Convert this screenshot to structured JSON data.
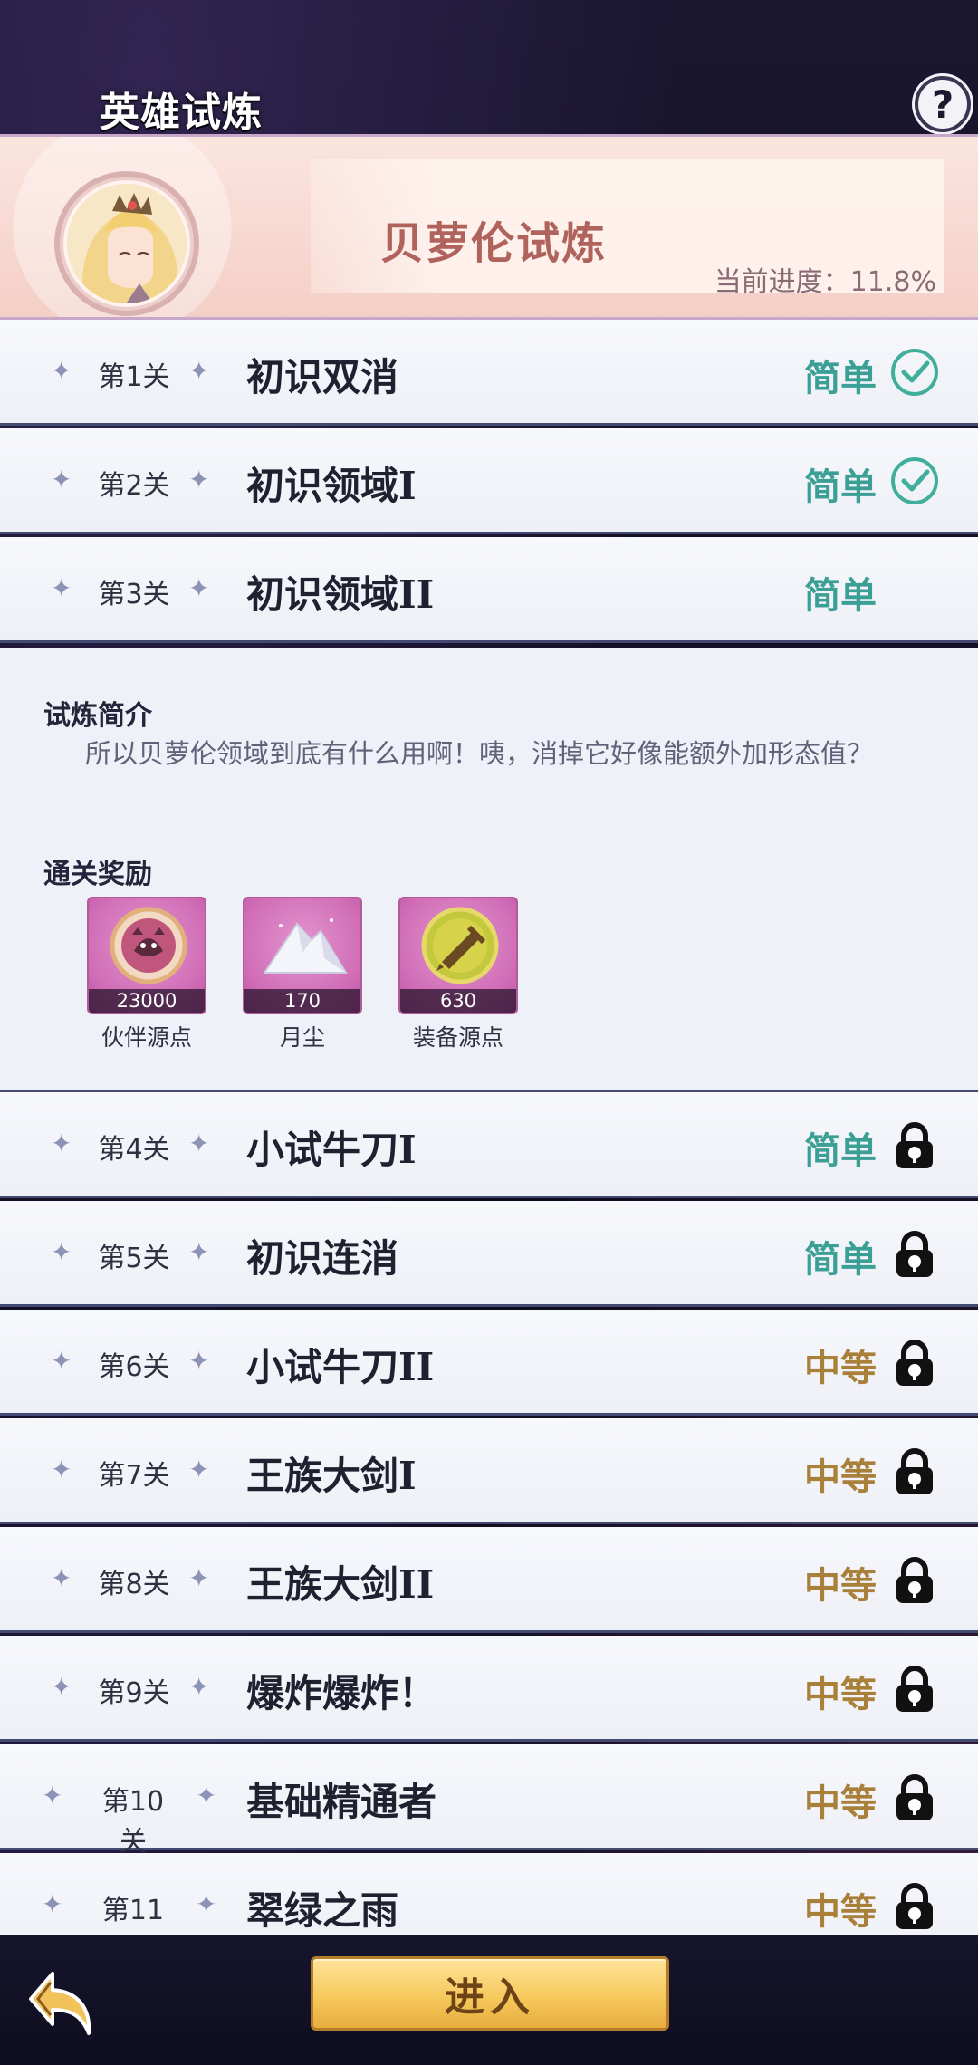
{
  "header": {
    "title": "英雄试炼",
    "help_label": "?"
  },
  "hero": {
    "name": "贝萝伦试炼",
    "progress": "当前进度：11.8%"
  },
  "levels": [
    {
      "stage": "第1关",
      "name": "初识双消",
      "difficulty": "简单",
      "status": "check-icon"
    },
    {
      "stage": "第2关",
      "name": "初识领域I",
      "difficulty": "简单",
      "status": "check-icon"
    },
    {
      "stage": "第3关",
      "name": "初识领域II",
      "difficulty": "简单",
      "status": "none"
    },
    {
      "stage": "第4关",
      "name": "小试牛刀I",
      "difficulty": "简单",
      "status": "lock-icon"
    },
    {
      "stage": "第5关",
      "name": "初识连消",
      "difficulty": "简单",
      "status": "lock-icon"
    },
    {
      "stage": "第6关",
      "name": "小试牛刀II",
      "difficulty": "中等",
      "status": "lock-icon"
    },
    {
      "stage": "第7关",
      "name": "王族大剑I",
      "difficulty": "中等",
      "status": "lock-icon"
    },
    {
      "stage": "第8关",
      "name": "王族大剑II",
      "difficulty": "中等",
      "status": "lock-icon"
    },
    {
      "stage": "第9关",
      "name": "爆炸爆炸！",
      "difficulty": "中等",
      "status": "lock-icon"
    },
    {
      "stage": "第10关",
      "name": "基础精通者",
      "difficulty": "中等",
      "status": "lock-icon"
    },
    {
      "stage": "第11关",
      "name": "翠绿之雨",
      "difficulty": "中等",
      "status": "lock-icon"
    }
  ],
  "detail": {
    "intro_title": "试炼简介",
    "intro_text": "所以贝萝伦领域到底有什么用啊！咦，消掉它好像能额外加形态值？",
    "reward_title": "通关奖励",
    "rewards": [
      {
        "count": "23000",
        "label": "伙伴源点",
        "icon": "partner-source-icon"
      },
      {
        "count": "170",
        "label": "月尘",
        "icon": "moon-dust-icon"
      },
      {
        "count": "630",
        "label": "装备源点",
        "icon": "equipment-source-icon"
      }
    ]
  },
  "footer": {
    "enter_label": "进入"
  },
  "colors": {
    "easy": "#3c9f96",
    "medium": "#a8803a",
    "enter_button": "#f6c95c"
  }
}
